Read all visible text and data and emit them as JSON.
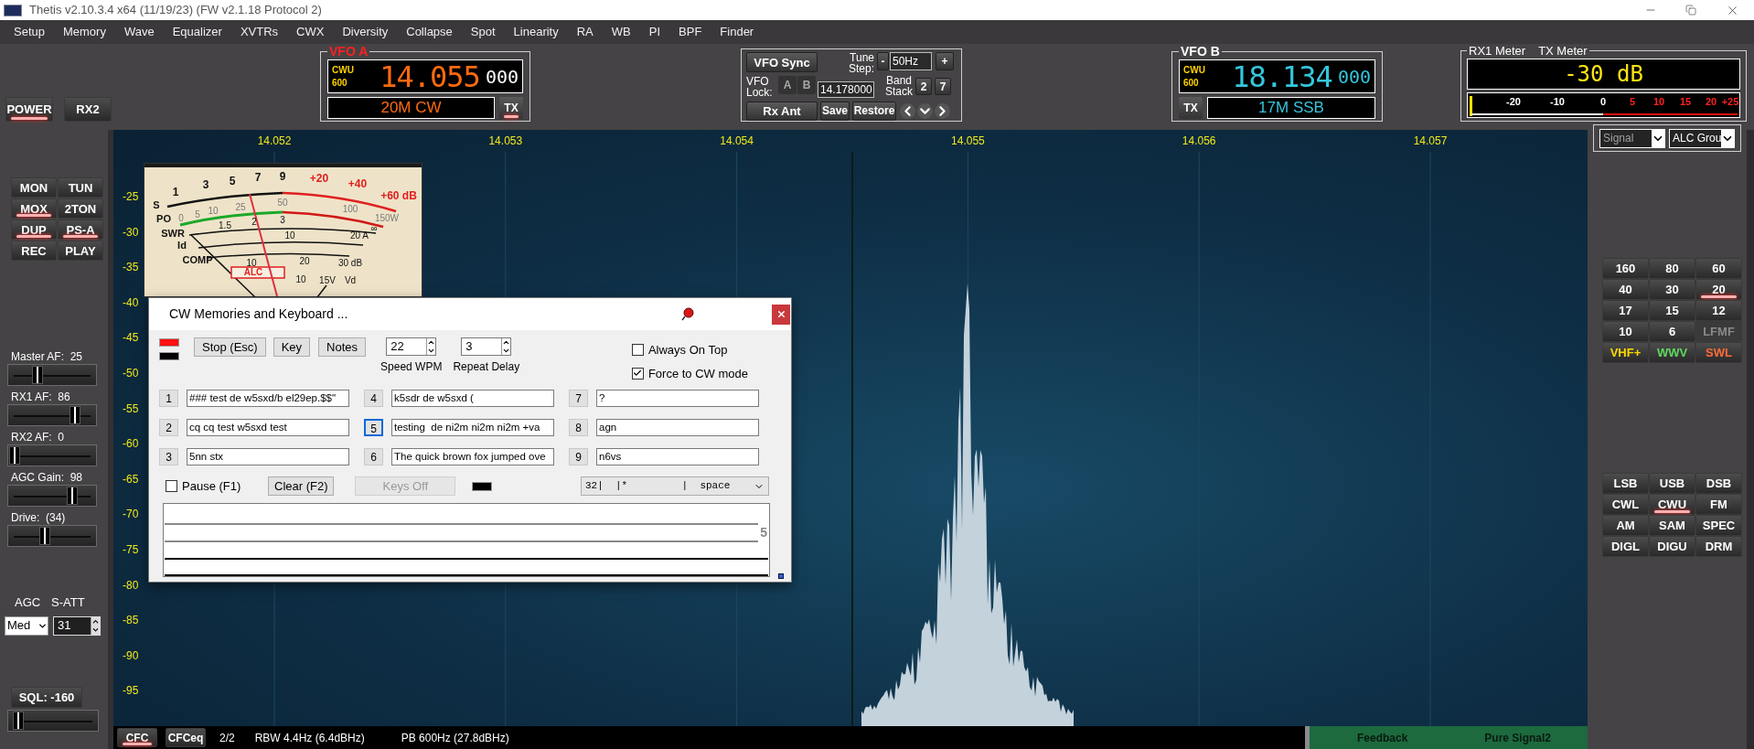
{
  "window": {
    "title": "Thetis v2.10.3.4 x64 (11/19/23) (FW v2.1.18 Protocol 2)"
  },
  "menu": [
    "Setup",
    "Memory",
    "Wave",
    "Equalizer",
    "XVTRs",
    "CWX",
    "Diversity",
    "Collapse",
    "Spot",
    "Linearity",
    "RA",
    "WB",
    "PI",
    "BPF",
    "Finder"
  ],
  "top_buttons": [
    {
      "label": "POWER",
      "on": true
    },
    {
      "label": "RX2",
      "on": false
    }
  ],
  "vfo_a": {
    "title": "VFO A",
    "mode": "CWU",
    "filter": "600",
    "frequency": "14.055",
    "sub_hz": "000",
    "band_mode": "20M CW",
    "tx_label": "TX",
    "tx_on": true
  },
  "vfo_controls": {
    "sync": "VFO Sync",
    "tune_step_label": "Tune Step:",
    "step_down": "-",
    "step": "50Hz",
    "step_up": "+",
    "lock_label": "VFO Lock:",
    "lock_buttons": [
      "A",
      "B"
    ],
    "frequency": "14.178000",
    "band_stack_label": "Band Stack",
    "band_stack": [
      "2",
      "7"
    ],
    "rx_ant": "Rx Ant",
    "save": "Save",
    "restore": "Restore"
  },
  "vfo_b": {
    "title": "VFO B",
    "mode": "CWU",
    "filter": "600",
    "frequency": "18.134",
    "sub_hz": "000",
    "band_mode": "17M SSB",
    "tx_label": "TX",
    "tx_on": false
  },
  "meter": {
    "rx_label": "RX1 Meter",
    "tx_label": "TX Meter",
    "reading": "-30 dB",
    "scale": [
      {
        "label": "-20",
        "over": false
      },
      {
        "label": "-10",
        "over": false
      },
      {
        "label": "0",
        "over": false
      },
      {
        "label": "5",
        "over": true
      },
      {
        "label": "10",
        "over": true
      },
      {
        "label": "15",
        "over": true
      },
      {
        "label": "20",
        "over": true
      },
      {
        "label": "+25",
        "over": true
      }
    ]
  },
  "meter_selectors": [
    {
      "value": "Signal",
      "disabled": true
    },
    {
      "value": "ALC Grou",
      "disabled": false
    }
  ],
  "left_panel": {
    "buttons": [
      {
        "label": "MON",
        "on": false
      },
      {
        "label": "TUN",
        "on": false
      },
      {
        "label": "MOX",
        "on": true
      },
      {
        "label": "2TON",
        "on": false
      },
      {
        "label": "DUP",
        "on": true
      },
      {
        "label": "PS-A",
        "on": true
      },
      {
        "label": "REC",
        "on": false
      },
      {
        "label": "PLAY",
        "on": false
      }
    ],
    "sliders": [
      {
        "label": "Master AF:  25",
        "level": 0.3
      },
      {
        "label": "RX1 AF:  86",
        "level": 0.8
      },
      {
        "label": "RX2 AF:  0",
        "level": 0
      },
      {
        "label": "AGC Gain:  98",
        "level": 0.77
      },
      {
        "label": "Drive:  (34)",
        "level": 0.4
      }
    ],
    "agc_label": "AGC",
    "agc_value": "Med",
    "satt_label": "S-ATT",
    "satt_value": "31",
    "sql": {
      "label": "SQL: -160",
      "level": 0.05
    }
  },
  "panadapter": {
    "frequency_labels": [
      "14.052",
      "14.053",
      "14.054",
      "14.055",
      "14.056",
      "14.057"
    ],
    "db_labels": [
      "-25",
      "-30",
      "-35",
      "-40",
      "-45",
      "-50",
      "-55",
      "-60",
      "-65",
      "-70",
      "-75",
      "-80",
      "-85",
      "-90",
      "-95"
    ]
  },
  "analog_meter": {
    "row_labels": [
      "S",
      "PO",
      "SWR",
      "Id",
      "COMP"
    ],
    "s_scale": [
      "1",
      "3",
      "5",
      "7",
      "9"
    ],
    "s_over_scale": [
      "+20",
      "+40",
      "+60 dB"
    ],
    "po_scale": [
      "0",
      "5",
      "10",
      "25",
      "50",
      "100",
      "150W"
    ],
    "swr_scale": [
      "1.5",
      "2",
      "3",
      "∞"
    ],
    "id_scale": [
      "10",
      "20 A"
    ],
    "comp_scale": [
      "10",
      "20",
      "30 dB"
    ],
    "alc_label": "ALC",
    "vd_scale": [
      "10",
      "15V",
      "Vd"
    ]
  },
  "cw_dialog": {
    "title": "CW Memories and Keyboard ...",
    "buttons": [
      "Stop (Esc)",
      "Key",
      "Notes"
    ],
    "speed": {
      "value": "22",
      "label": "Speed WPM"
    },
    "repeat": {
      "value": "3",
      "label": "Repeat Delay"
    },
    "options": [
      {
        "label": "Always On Top",
        "checked": false
      },
      {
        "label": "Force to CW mode",
        "checked": true
      }
    ],
    "memories": [
      {
        "number": "1",
        "text": "### test de w5sxd/b el29ep.$$\"",
        "focused": false
      },
      {
        "number": "2",
        "text": "cq cq test w5sxd test",
        "focused": false
      },
      {
        "number": "3",
        "text": "5nn stx",
        "focused": false
      },
      {
        "number": "4",
        "text": "k5sdr de w5sxd (",
        "focused": false
      },
      {
        "number": "5",
        "text": "testing  de ni2m ni2m ni2m +va",
        "focused": true
      },
      {
        "number": "6",
        "text": "The quick brown fox jumped ove",
        "focused": false
      },
      {
        "number": "7",
        "text": "?",
        "focused": false
      },
      {
        "number": "8",
        "text": "agn",
        "focused": false
      },
      {
        "number": "9",
        "text": "n6vs",
        "focused": false
      }
    ],
    "pause": {
      "label": "Pause (F1)",
      "checked": false
    },
    "clear": "Clear (F2)",
    "keys_off": {
      "label": "Keys Off",
      "disabled": true
    },
    "char_select": "32|  |*         |  space",
    "log_mark": "5"
  },
  "bands": [
    {
      "label": "160",
      "selected": false,
      "disabled": false,
      "color": "#ffffff"
    },
    {
      "label": "80",
      "selected": false,
      "disabled": false,
      "color": "#ffffff"
    },
    {
      "label": "60",
      "selected": false,
      "disabled": false,
      "color": "#ffffff"
    },
    {
      "label": "40",
      "selected": false,
      "disabled": false,
      "color": "#ffffff"
    },
    {
      "label": "30",
      "selected": false,
      "disabled": false,
      "color": "#ffffff"
    },
    {
      "label": "20",
      "selected": true,
      "disabled": false,
      "color": "#ffffff"
    },
    {
      "label": "17",
      "selected": false,
      "disabled": false,
      "color": "#ffffff"
    },
    {
      "label": "15",
      "selected": false,
      "disabled": false,
      "color": "#ffffff"
    },
    {
      "label": "12",
      "selected": false,
      "disabled": false,
      "color": "#ffffff"
    },
    {
      "label": "10",
      "selected": false,
      "disabled": false,
      "color": "#ffffff"
    },
    {
      "label": "6",
      "selected": false,
      "disabled": false,
      "color": "#ffffff"
    },
    {
      "label": "LFMF",
      "selected": false,
      "disabled": true,
      "color": "#8a8a8a"
    },
    {
      "label": "VHF+",
      "selected": false,
      "disabled": false,
      "color": "#ffd800"
    },
    {
      "label": "WWV",
      "selected": false,
      "disabled": false,
      "color": "#5ed85e"
    },
    {
      "label": "SWL",
      "selected": false,
      "disabled": false,
      "color": "#ff6a3a"
    }
  ],
  "modes": [
    {
      "label": "LSB",
      "selected": false
    },
    {
      "label": "USB",
      "selected": false
    },
    {
      "label": "DSB",
      "selected": false
    },
    {
      "label": "CWL",
      "selected": false
    },
    {
      "label": "CWU",
      "selected": true
    },
    {
      "label": "FM",
      "selected": false
    },
    {
      "label": "AM",
      "selected": false
    },
    {
      "label": "SAM",
      "selected": false
    },
    {
      "label": "SPEC",
      "selected": false
    },
    {
      "label": "DIGL",
      "selected": false
    },
    {
      "label": "DIGU",
      "selected": false
    },
    {
      "label": "DRM",
      "selected": false
    }
  ],
  "status_bar": {
    "buttons": [
      {
        "label": "CFC",
        "on": true
      },
      {
        "label": "CFCeq",
        "on": false
      }
    ],
    "page": "2/2",
    "rbw": "RBW 4.4Hz (6.4dBHz)",
    "pb": "PB 600Hz (27.8dBHz)",
    "feedback": "Feedback",
    "pure_signal": "Pure Signal2"
  }
}
